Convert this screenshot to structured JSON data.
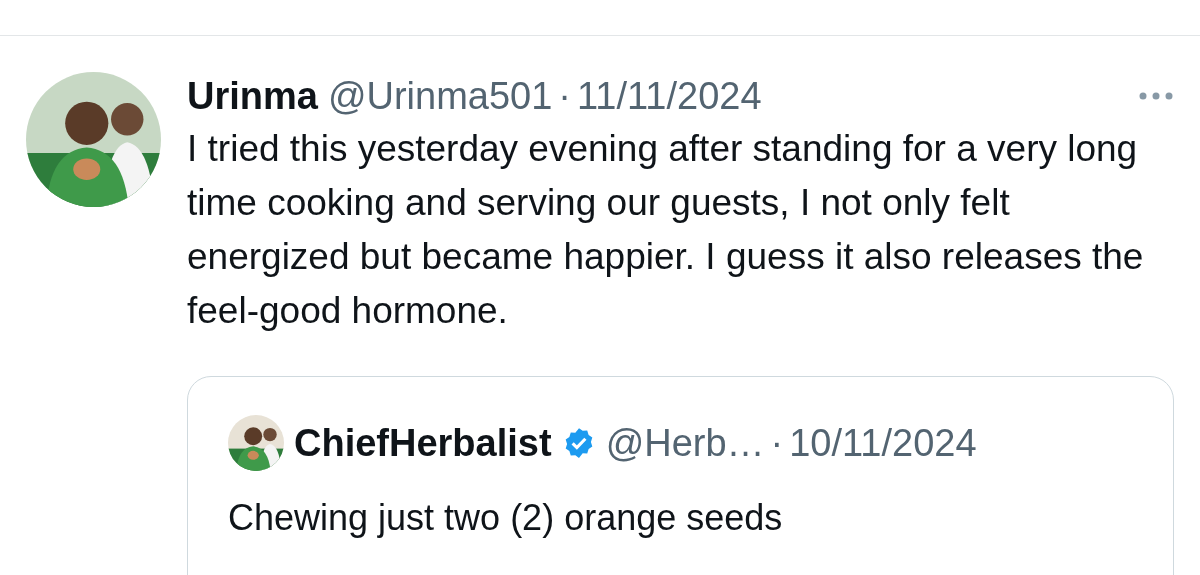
{
  "post": {
    "author": {
      "name": "Urinma",
      "handle": "@Urinma501",
      "separator": "·",
      "date": "11/11/2024"
    },
    "text": "I tried this yesterday evening after standing for a very long time cooking and serving our guests, I not only felt energized but became happier. I guess it also releases the feel-good hormone.",
    "quoted": {
      "name": "ChiefHerbalist",
      "verified": true,
      "handle": "@Herb…",
      "separator": "·",
      "date": "10/11/2024",
      "text": "Chewing just two (2) orange seeds"
    }
  }
}
